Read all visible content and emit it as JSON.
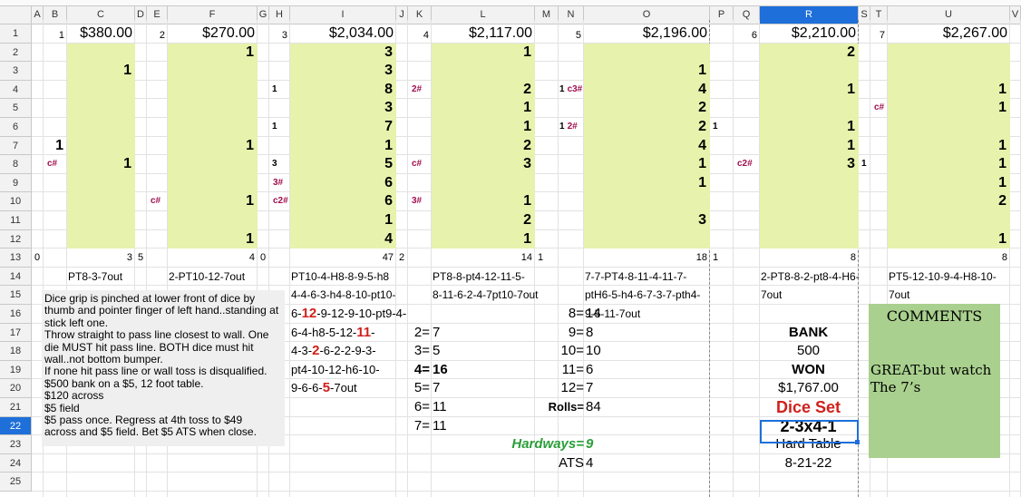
{
  "colors": {
    "block": "#e7f2ac",
    "desc_bg": "#efefef",
    "comments_bg": "#a9d08e",
    "selection": "#1e6fd9",
    "note": "#a0104e",
    "red": "#d0211c",
    "green": "#2c9e3a"
  },
  "columns": [
    "A",
    "B",
    "C",
    "D",
    "E",
    "F",
    "G",
    "H",
    "I",
    "J",
    "K",
    "L",
    "M",
    "N",
    "O",
    "P",
    "Q",
    "R",
    "S",
    "T",
    "U",
    "V"
  ],
  "rows": [
    "1",
    "2",
    "3",
    "4",
    "5",
    "6",
    "7",
    "8",
    "9",
    "10",
    "11",
    "12",
    "13",
    "14",
    "15",
    "16",
    "17",
    "18",
    "19",
    "20",
    "21",
    "22",
    "23",
    "24",
    "25"
  ],
  "selected": {
    "column": "R",
    "row": "22"
  },
  "sets": [
    {
      "index": "1",
      "total": "$380.00",
      "count": "3",
      "start": "0",
      "seq": [
        "PT8-3-7out"
      ]
    },
    {
      "index": "2",
      "total": "$270.00",
      "count": "4",
      "start": "5",
      "seq": [
        "2-PT10-12-7out"
      ]
    },
    {
      "index": "3",
      "total": "$2,034.00",
      "count": "47",
      "start": "0",
      "seq": [
        "PT10-4-H8-8-9-5-h8",
        "4-4-6-3-h4-8-10-pt10-"
      ]
    },
    {
      "index": "4",
      "total": "$2,117.00",
      "count": "14",
      "start": "2",
      "seq": [
        "PT8-8-pt4-12-11-5-",
        "8-11-6-2-4-7pt10-7out"
      ]
    },
    {
      "index": "5",
      "total": "$2,196.00",
      "count": "18",
      "start": "1",
      "seq": [
        "7-7-PT4-8-11-4-11-7-",
        "ptH6-5-h4-6-7-3-7-pth4-",
        "9-5-11-7out"
      ]
    },
    {
      "index": "6",
      "total": "$2,210.00",
      "count": "8",
      "start": "1",
      "seq": [
        "2-PT8-8-2-pt8-4-H6-",
        "7out"
      ]
    },
    {
      "index": "7",
      "total": "$2,267.00",
      "count": "8",
      "start": "",
      "seq": [
        "PT5-12-10-9-4-H8-10-",
        "7out"
      ]
    }
  ],
  "set3_more": {
    "line3a": "6-",
    "line3b": "12",
    "line3c": "-9-12-9-10-pt9-4-",
    "line4a": "6-4-h8-5-12-",
    "line4b": "11",
    "line4c": "-",
    "line5a": "4-3-",
    "line5b": "2",
    "line5c": "-6-2-2-9-3-",
    "line6": "pt4-10-12-h6-10-",
    "line7a": "9-6-6-",
    "line7b": "5",
    "line7c": "-7out"
  },
  "cols_numbers": {
    "C": [
      {
        "row": "3",
        "v": "1"
      },
      {
        "row": "8",
        "v": "1"
      }
    ],
    "B": [
      {
        "row": "7",
        "v": "1"
      }
    ],
    "F": [
      {
        "row": "2",
        "v": "1"
      },
      {
        "row": "7",
        "v": "1"
      },
      {
        "row": "10",
        "v": "1"
      },
      {
        "row": "12",
        "v": "1"
      }
    ],
    "I": [
      {
        "row": "2",
        "v": "3"
      },
      {
        "row": "3",
        "v": "3"
      },
      {
        "row": "4",
        "v": "8"
      },
      {
        "row": "5",
        "v": "3"
      },
      {
        "row": "6",
        "v": "7"
      },
      {
        "row": "7",
        "v": "1"
      },
      {
        "row": "8",
        "v": "5"
      },
      {
        "row": "9",
        "v": "6"
      },
      {
        "row": "10",
        "v": "6"
      },
      {
        "row": "11",
        "v": "1"
      },
      {
        "row": "12",
        "v": "4"
      }
    ],
    "L": [
      {
        "row": "2",
        "v": "1"
      },
      {
        "row": "4",
        "v": "2"
      },
      {
        "row": "5",
        "v": "1"
      },
      {
        "row": "6",
        "v": "1"
      },
      {
        "row": "7",
        "v": "2"
      },
      {
        "row": "8",
        "v": "3"
      },
      {
        "row": "10",
        "v": "1"
      },
      {
        "row": "11",
        "v": "2"
      },
      {
        "row": "12",
        "v": "1"
      }
    ],
    "O": [
      {
        "row": "3",
        "v": "1"
      },
      {
        "row": "4",
        "v": "4"
      },
      {
        "row": "5",
        "v": "2"
      },
      {
        "row": "6",
        "v": "2"
      },
      {
        "row": "7",
        "v": "4"
      },
      {
        "row": "8",
        "v": "1"
      },
      {
        "row": "9",
        "v": "1"
      },
      {
        "row": "11",
        "v": "3"
      }
    ],
    "R": [
      {
        "row": "2",
        "v": "2"
      },
      {
        "row": "4",
        "v": "1"
      },
      {
        "row": "6",
        "v": "1"
      },
      {
        "row": "7",
        "v": "1"
      },
      {
        "row": "8",
        "v": "3"
      }
    ],
    "U": [
      {
        "row": "4",
        "v": "1"
      },
      {
        "row": "5",
        "v": "1"
      },
      {
        "row": "7",
        "v": "1"
      },
      {
        "row": "8",
        "v": "1"
      },
      {
        "row": "9",
        "v": "1"
      },
      {
        "row": "10",
        "v": "2"
      },
      {
        "row": "12",
        "v": "1"
      }
    ]
  },
  "small_numbers": {
    "H4": "1",
    "H6": "1",
    "H8": "3",
    "N4": "1",
    "N6": "1",
    "P6": "1",
    "S8": "1"
  },
  "notes": {
    "B8": "c#",
    "E10": "c#",
    "H9": "3#",
    "H10": "c2#",
    "K4": "2#",
    "K8": "c#",
    "K10": "3#",
    "N4": "c3#",
    "N6": "2#",
    "Q8": "c2#",
    "T5": "c#"
  },
  "description": [
    "Dice grip is pinched at lower front of dice by",
    "thumb and pointer finger of left hand..standing at",
    "stick left one.",
    "Throw straight to pass line closest to wall. One",
    "die MUST hit pass line. BOTH dice must hit",
    "wall..not bottom bumper.",
    "If none hit pass line or wall toss is disqualified.",
    "$500 bank  on a $5, 12 foot table.",
    "$120 across",
    "$5 field",
    "$5 pass once.   Regress at 4th toss to $49",
    "across and $5 field. Bet $5 ATS when close."
  ],
  "stats_left": [
    {
      "label": "2=",
      "value": "7"
    },
    {
      "label": "3=",
      "value": "5"
    },
    {
      "label": "4=",
      "value": "16"
    },
    {
      "label": "5=",
      "value": "7"
    },
    {
      "label": "6=",
      "value": "11"
    },
    {
      "label": "7=",
      "value": "11"
    }
  ],
  "stats_right": [
    {
      "label": "8=",
      "value": "14"
    },
    {
      "label": "9=",
      "value": "8"
    },
    {
      "label": "10=",
      "value": "10"
    },
    {
      "label": "11=",
      "value": "6"
    },
    {
      "label": "12=",
      "value": "7"
    },
    {
      "label": "Rolls=",
      "value": "84"
    }
  ],
  "hardways": {
    "label": "Hardways=",
    "value": "9"
  },
  "ats": {
    "label": "ATS",
    "value": "4"
  },
  "summary": {
    "bank_label": "BANK",
    "bank": "500",
    "won_label": "WON",
    "won": "$1,767.00",
    "dice_set_label": "Dice Set",
    "dice_set": "2-3x4-1",
    "table": "Hard Table",
    "date": "8-21-22"
  },
  "comments": {
    "title": "COMMENTS",
    "body": "GREAT-but watch The 7’s"
  }
}
